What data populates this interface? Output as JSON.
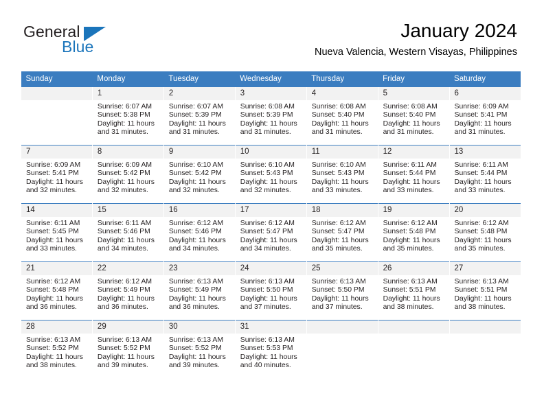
{
  "brand": {
    "name_top": "General",
    "name_bottom": "Blue",
    "accent_color": "#1b75bb",
    "triangle_icon": "triangle-icon"
  },
  "header": {
    "title": "January 2024",
    "subtitle": "Nueva Valencia, Western Visayas, Philippines"
  },
  "calendar": {
    "header_bg": "#3b7dc0",
    "day_cell_bg": "#f2f2f2",
    "weekday_headers": [
      "Sunday",
      "Monday",
      "Tuesday",
      "Wednesday",
      "Thursday",
      "Friday",
      "Saturday"
    ],
    "weeks": [
      [
        {
          "day": "",
          "lines": []
        },
        {
          "day": "1",
          "lines": [
            "Sunrise: 6:07 AM",
            "Sunset: 5:38 PM",
            "Daylight: 11 hours",
            "and 31 minutes."
          ]
        },
        {
          "day": "2",
          "lines": [
            "Sunrise: 6:07 AM",
            "Sunset: 5:39 PM",
            "Daylight: 11 hours",
            "and 31 minutes."
          ]
        },
        {
          "day": "3",
          "lines": [
            "Sunrise: 6:08 AM",
            "Sunset: 5:39 PM",
            "Daylight: 11 hours",
            "and 31 minutes."
          ]
        },
        {
          "day": "4",
          "lines": [
            "Sunrise: 6:08 AM",
            "Sunset: 5:40 PM",
            "Daylight: 11 hours",
            "and 31 minutes."
          ]
        },
        {
          "day": "5",
          "lines": [
            "Sunrise: 6:08 AM",
            "Sunset: 5:40 PM",
            "Daylight: 11 hours",
            "and 31 minutes."
          ]
        },
        {
          "day": "6",
          "lines": [
            "Sunrise: 6:09 AM",
            "Sunset: 5:41 PM",
            "Daylight: 11 hours",
            "and 31 minutes."
          ]
        }
      ],
      [
        {
          "day": "7",
          "lines": [
            "Sunrise: 6:09 AM",
            "Sunset: 5:41 PM",
            "Daylight: 11 hours",
            "and 32 minutes."
          ]
        },
        {
          "day": "8",
          "lines": [
            "Sunrise: 6:09 AM",
            "Sunset: 5:42 PM",
            "Daylight: 11 hours",
            "and 32 minutes."
          ]
        },
        {
          "day": "9",
          "lines": [
            "Sunrise: 6:10 AM",
            "Sunset: 5:42 PM",
            "Daylight: 11 hours",
            "and 32 minutes."
          ]
        },
        {
          "day": "10",
          "lines": [
            "Sunrise: 6:10 AM",
            "Sunset: 5:43 PM",
            "Daylight: 11 hours",
            "and 32 minutes."
          ]
        },
        {
          "day": "11",
          "lines": [
            "Sunrise: 6:10 AM",
            "Sunset: 5:43 PM",
            "Daylight: 11 hours",
            "and 33 minutes."
          ]
        },
        {
          "day": "12",
          "lines": [
            "Sunrise: 6:11 AM",
            "Sunset: 5:44 PM",
            "Daylight: 11 hours",
            "and 33 minutes."
          ]
        },
        {
          "day": "13",
          "lines": [
            "Sunrise: 6:11 AM",
            "Sunset: 5:44 PM",
            "Daylight: 11 hours",
            "and 33 minutes."
          ]
        }
      ],
      [
        {
          "day": "14",
          "lines": [
            "Sunrise: 6:11 AM",
            "Sunset: 5:45 PM",
            "Daylight: 11 hours",
            "and 33 minutes."
          ]
        },
        {
          "day": "15",
          "lines": [
            "Sunrise: 6:11 AM",
            "Sunset: 5:46 PM",
            "Daylight: 11 hours",
            "and 34 minutes."
          ]
        },
        {
          "day": "16",
          "lines": [
            "Sunrise: 6:12 AM",
            "Sunset: 5:46 PM",
            "Daylight: 11 hours",
            "and 34 minutes."
          ]
        },
        {
          "day": "17",
          "lines": [
            "Sunrise: 6:12 AM",
            "Sunset: 5:47 PM",
            "Daylight: 11 hours",
            "and 34 minutes."
          ]
        },
        {
          "day": "18",
          "lines": [
            "Sunrise: 6:12 AM",
            "Sunset: 5:47 PM",
            "Daylight: 11 hours",
            "and 35 minutes."
          ]
        },
        {
          "day": "19",
          "lines": [
            "Sunrise: 6:12 AM",
            "Sunset: 5:48 PM",
            "Daylight: 11 hours",
            "and 35 minutes."
          ]
        },
        {
          "day": "20",
          "lines": [
            "Sunrise: 6:12 AM",
            "Sunset: 5:48 PM",
            "Daylight: 11 hours",
            "and 35 minutes."
          ]
        }
      ],
      [
        {
          "day": "21",
          "lines": [
            "Sunrise: 6:12 AM",
            "Sunset: 5:48 PM",
            "Daylight: 11 hours",
            "and 36 minutes."
          ]
        },
        {
          "day": "22",
          "lines": [
            "Sunrise: 6:12 AM",
            "Sunset: 5:49 PM",
            "Daylight: 11 hours",
            "and 36 minutes."
          ]
        },
        {
          "day": "23",
          "lines": [
            "Sunrise: 6:13 AM",
            "Sunset: 5:49 PM",
            "Daylight: 11 hours",
            "and 36 minutes."
          ]
        },
        {
          "day": "24",
          "lines": [
            "Sunrise: 6:13 AM",
            "Sunset: 5:50 PM",
            "Daylight: 11 hours",
            "and 37 minutes."
          ]
        },
        {
          "day": "25",
          "lines": [
            "Sunrise: 6:13 AM",
            "Sunset: 5:50 PM",
            "Daylight: 11 hours",
            "and 37 minutes."
          ]
        },
        {
          "day": "26",
          "lines": [
            "Sunrise: 6:13 AM",
            "Sunset: 5:51 PM",
            "Daylight: 11 hours",
            "and 38 minutes."
          ]
        },
        {
          "day": "27",
          "lines": [
            "Sunrise: 6:13 AM",
            "Sunset: 5:51 PM",
            "Daylight: 11 hours",
            "and 38 minutes."
          ]
        }
      ],
      [
        {
          "day": "28",
          "lines": [
            "Sunrise: 6:13 AM",
            "Sunset: 5:52 PM",
            "Daylight: 11 hours",
            "and 38 minutes."
          ]
        },
        {
          "day": "29",
          "lines": [
            "Sunrise: 6:13 AM",
            "Sunset: 5:52 PM",
            "Daylight: 11 hours",
            "and 39 minutes."
          ]
        },
        {
          "day": "30",
          "lines": [
            "Sunrise: 6:13 AM",
            "Sunset: 5:52 PM",
            "Daylight: 11 hours",
            "and 39 minutes."
          ]
        },
        {
          "day": "31",
          "lines": [
            "Sunrise: 6:13 AM",
            "Sunset: 5:53 PM",
            "Daylight: 11 hours",
            "and 40 minutes."
          ]
        },
        {
          "day": "",
          "lines": []
        },
        {
          "day": "",
          "lines": []
        },
        {
          "day": "",
          "lines": []
        }
      ]
    ]
  }
}
